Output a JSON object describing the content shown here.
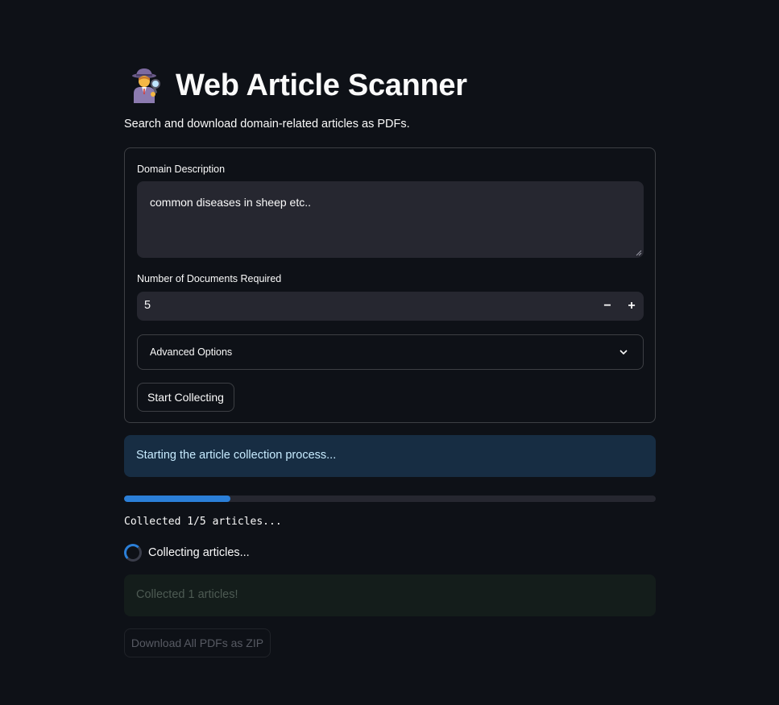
{
  "header": {
    "title": "Web Article Scanner",
    "title_icon": "detective-icon",
    "subtitle": "Search and download domain-related articles as PDFs."
  },
  "form": {
    "domain_label": "Domain Description",
    "domain_value": "common diseases in sheep etc..",
    "num_docs_label": "Number of Documents Required",
    "num_docs_value": "5",
    "decrement_label": "−",
    "increment_label": "+",
    "advanced_label": "Advanced Options",
    "start_button_label": "Start Collecting"
  },
  "status": {
    "info_message": "Starting the article collection process...",
    "progress_fraction": 0.2,
    "progress_text": "Collected 1/5 articles...",
    "spinner_text": "Collecting articles...",
    "success_message": "Collected 1 articles!",
    "download_button_label": "Download All PDFs as ZIP"
  },
  "colors": {
    "background": "#0e1117",
    "input_background": "#262730",
    "accent": "#2b7fd8",
    "info_background": "#172d43",
    "success_background": "#141d1b"
  }
}
